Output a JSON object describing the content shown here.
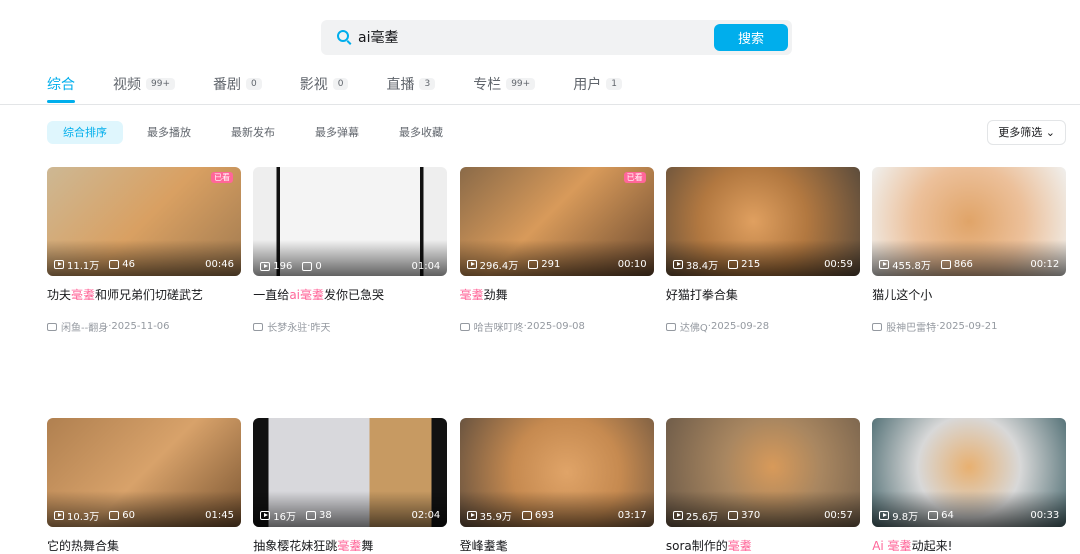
{
  "search": {
    "value": "ai毫耋",
    "button": "搜索"
  },
  "tabs": [
    {
      "label": "综合",
      "count": null,
      "active": true
    },
    {
      "label": "视频",
      "count": "99+"
    },
    {
      "label": "番剧",
      "count": "0"
    },
    {
      "label": "影视",
      "count": "0"
    },
    {
      "label": "直播",
      "count": "3"
    },
    {
      "label": "专栏",
      "count": "99+"
    },
    {
      "label": "用户",
      "count": "1"
    }
  ],
  "sorts": [
    {
      "label": "综合排序",
      "active": true
    },
    {
      "label": "最多播放"
    },
    {
      "label": "最新发布"
    },
    {
      "label": "最多弹幕"
    },
    {
      "label": "最多收藏"
    }
  ],
  "more_filter": "更多筛选",
  "colors": {
    "accent": "#00aeec",
    "highlight": "#ff6699"
  },
  "videos": [
    {
      "title": [
        {
          "t": "功夫"
        },
        {
          "t": "毫耋",
          "hl": true
        },
        {
          "t": "和师兄弟们切磋武艺"
        }
      ],
      "plays": "11.1万",
      "danmaku": "46",
      "duration": "00:46",
      "author": "闲鱼--翻身",
      "date": "2025-11-06",
      "badge": "已看",
      "bg": "linear-gradient(135deg,#cdb894,#d9a062 50%,#a07a50)"
    },
    {
      "title": [
        {
          "t": "一直给"
        },
        {
          "t": "ai毫耋",
          "hl": true
        },
        {
          "t": "发你已急哭"
        }
      ],
      "plays": "196",
      "danmaku": "0",
      "duration": "01:04",
      "author": "长梦永驻",
      "date": "昨天",
      "bg": "linear-gradient(90deg,#eee 0 12%,#111 12% 14%,#f4f4f4 14% 86%,#111 86% 88%,#eee 88%)"
    },
    {
      "title": [
        {
          "t": "毫耋",
          "hl": true
        },
        {
          "t": "劲舞"
        }
      ],
      "plays": "296.4万",
      "danmaku": "291",
      "duration": "00:10",
      "author": "哈吉咪叮咚",
      "date": "2025-09-08",
      "badge": "已看",
      "bg": "linear-gradient(135deg,#8a6a48,#d89a5a 45%,#6b4a30)"
    },
    {
      "title": [
        {
          "t": "好猫打拳合集"
        }
      ],
      "plays": "38.4万",
      "danmaku": "215",
      "duration": "00:59",
      "author": "达佛Q",
      "date": "2025-09-28",
      "bg": "radial-gradient(circle at 45% 50%,#e0a060,#b27840 45%,#5c4c3c)"
    },
    {
      "title": [
        {
          "t": "猫儿这个小"
        }
      ],
      "plays": "455.8万",
      "danmaku": "866",
      "duration": "00:12",
      "author": "股神巴雷特",
      "date": "2025-09-21",
      "bg": "radial-gradient(circle at 50% 50%,#e0a468,#ecc09a 50%,#f0f0ee)"
    },
    {
      "title": [
        {
          "t": "它的热舞合集"
        }
      ],
      "plays": "10.3万",
      "danmaku": "60",
      "duration": "01:45",
      "author": "",
      "date": "",
      "bg": "linear-gradient(135deg,#b08050,#d8a26a 50%,#7a5532)"
    },
    {
      "title": [
        {
          "t": "抽象樱花妹狂跳"
        },
        {
          "t": "毫耋",
          "hl": true
        },
        {
          "t": "舞"
        }
      ],
      "plays": "16万",
      "danmaku": "38",
      "duration": "02:04",
      "author": "",
      "date": "",
      "bg": "linear-gradient(90deg,#111 0 8%,#d8d8dc 8% 60%,#c79a62 60% 92%,#111 92%)"
    },
    {
      "title": [
        {
          "t": "登峰耋耄"
        }
      ],
      "plays": "35.9万",
      "danmaku": "693",
      "duration": "03:17",
      "author": "",
      "date": "",
      "bg": "radial-gradient(circle at 55% 50%,#e0a468,#c68a50 45%,#6a5440)"
    },
    {
      "title": [
        {
          "t": "sora制作的"
        },
        {
          "t": "毫耋",
          "hl": true
        }
      ],
      "plays": "25.6万",
      "danmaku": "370",
      "duration": "00:57",
      "author": "",
      "date": "",
      "bg": "radial-gradient(circle at 55% 45%,#d89a5a,#a88660 40%,#6c5a48)"
    },
    {
      "title": [
        {
          "t": "Ai ",
          "hl": true
        },
        {
          "t": "毫耋",
          "hl": true
        },
        {
          "t": "动起来!"
        }
      ],
      "plays": "9.8万",
      "danmaku": "64",
      "duration": "00:33",
      "author": "",
      "date": "",
      "bg": "radial-gradient(circle at 50% 45%,#e8b070,#d8d8d8 45%,#4a6a70)"
    }
  ]
}
